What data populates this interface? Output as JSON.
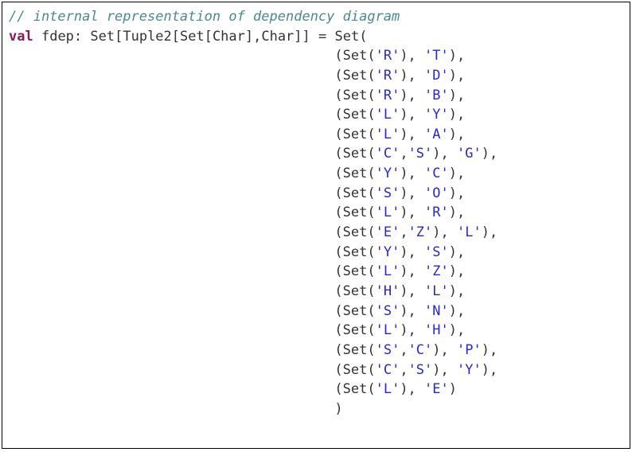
{
  "code": {
    "comment": "// internal representation of dependency diagram",
    "keyword_val": "val",
    "varname": "fdep",
    "colon": ":",
    "type_decl": "Set[Tuple2[Set[Char],Char]]",
    "eq": "=",
    "set_open": "Set(",
    "indent": "                                        ",
    "entries": [
      {
        "open": "(Set(",
        "keys": [
          "'R'"
        ],
        "mid": "), ",
        "val": "'T'",
        "close": "),"
      },
      {
        "open": "(Set(",
        "keys": [
          "'R'"
        ],
        "mid": "), ",
        "val": "'D'",
        "close": "),"
      },
      {
        "open": "(Set(",
        "keys": [
          "'R'"
        ],
        "mid": "), ",
        "val": "'B'",
        "close": "),"
      },
      {
        "open": "(Set(",
        "keys": [
          "'L'"
        ],
        "mid": "), ",
        "val": "'Y'",
        "close": "),"
      },
      {
        "open": "(Set(",
        "keys": [
          "'L'"
        ],
        "mid": "), ",
        "val": "'A'",
        "close": "),"
      },
      {
        "open": "(Set(",
        "keys": [
          "'C'",
          "'S'"
        ],
        "mid": "), ",
        "val": "'G'",
        "close": "),"
      },
      {
        "open": "(Set(",
        "keys": [
          "'Y'"
        ],
        "mid": "), ",
        "val": "'C'",
        "close": "),"
      },
      {
        "open": "(Set(",
        "keys": [
          "'S'"
        ],
        "mid": "), ",
        "val": "'O'",
        "close": "),"
      },
      {
        "open": "(Set(",
        "keys": [
          "'L'"
        ],
        "mid": "), ",
        "val": "'R'",
        "close": "),"
      },
      {
        "open": "(Set(",
        "keys": [
          "'E'",
          "'Z'"
        ],
        "mid": "), ",
        "val": "'L'",
        "close": "),"
      },
      {
        "open": "(Set(",
        "keys": [
          "'Y'"
        ],
        "mid": "), ",
        "val": "'S'",
        "close": "),"
      },
      {
        "open": "(Set(",
        "keys": [
          "'L'"
        ],
        "mid": "), ",
        "val": "'Z'",
        "close": "),"
      },
      {
        "open": "(Set(",
        "keys": [
          "'H'"
        ],
        "mid": "), ",
        "val": "'L'",
        "close": "),"
      },
      {
        "open": "(Set(",
        "keys": [
          "'S'"
        ],
        "mid": "), ",
        "val": "'N'",
        "close": "),"
      },
      {
        "open": "(Set(",
        "keys": [
          "'L'"
        ],
        "mid": "), ",
        "val": "'H'",
        "close": "),"
      },
      {
        "open": "(Set(",
        "keys": [
          "'S'",
          "'C'"
        ],
        "mid": "), ",
        "val": "'P'",
        "close": "),"
      },
      {
        "open": "(Set(",
        "keys": [
          "'C'",
          "'S'"
        ],
        "mid": "), ",
        "val": "'Y'",
        "close": "),"
      },
      {
        "open": "(Set(",
        "keys": [
          "'L'"
        ],
        "mid": "), ",
        "val": "'E'",
        "close": ")"
      }
    ],
    "set_close": ")"
  }
}
